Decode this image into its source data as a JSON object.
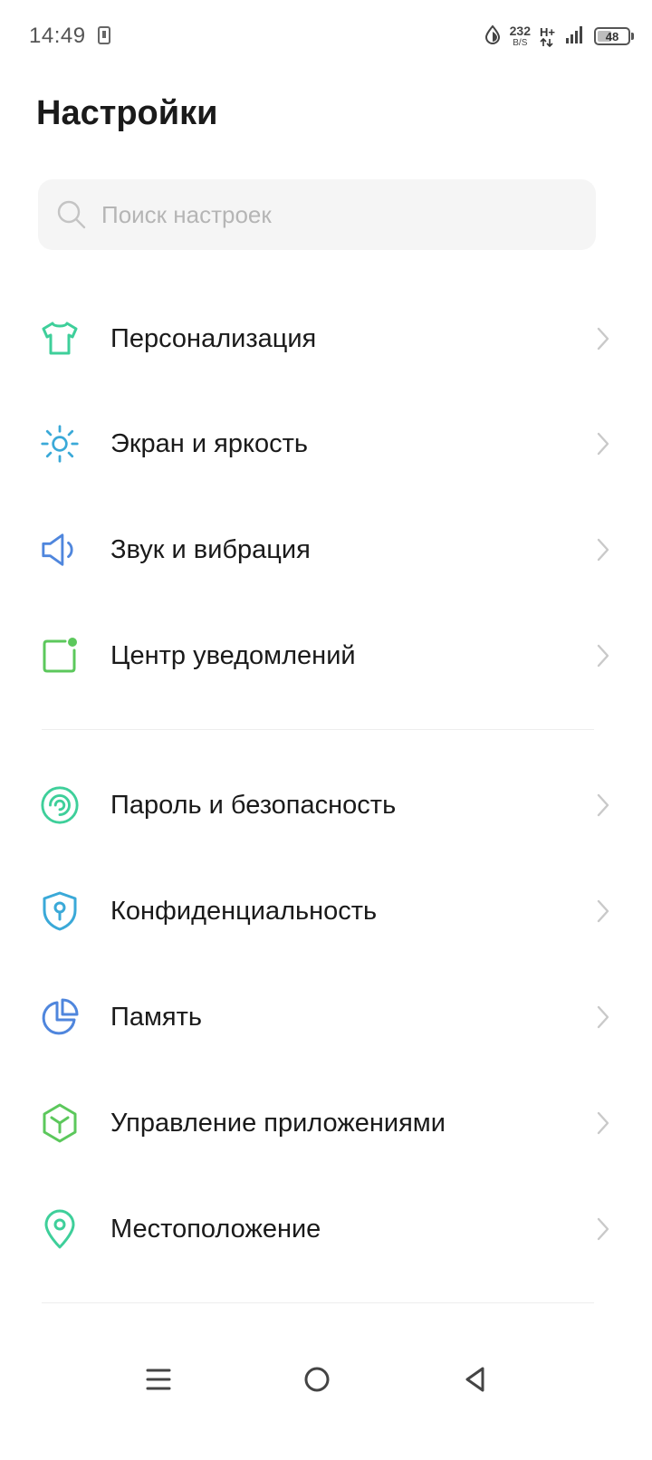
{
  "status_bar": {
    "time": "14:49",
    "net_speed_value": "232",
    "net_speed_unit": "B/S",
    "network_type": "H+",
    "battery_level": "48",
    "battery_percent": 48
  },
  "header": {
    "title": "Настройки"
  },
  "search": {
    "placeholder": "Поиск настроек",
    "value": ""
  },
  "settings": {
    "items": [
      {
        "label": "Персонализация",
        "icon": "tshirt-icon",
        "color": "#3ecf9a"
      },
      {
        "label": "Экран и яркость",
        "icon": "sun-icon",
        "color": "#3aa9d8"
      },
      {
        "label": "Звук и вибрация",
        "icon": "speaker-icon",
        "color": "#4f86dd"
      },
      {
        "label": "Центр уведомлений",
        "icon": "notification-icon",
        "color": "#5cc85c"
      },
      {
        "label": "Пароль и безопасность",
        "icon": "fingerprint-icon",
        "color": "#3ecf9a"
      },
      {
        "label": "Конфиденциальность",
        "icon": "shield-icon",
        "color": "#3aa9d8"
      },
      {
        "label": "Память",
        "icon": "pie-chart-icon",
        "color": "#4f86dd"
      },
      {
        "label": "Управление приложениями",
        "icon": "cube-icon",
        "color": "#5cc85c"
      },
      {
        "label": "Местоположение",
        "icon": "location-pin-icon",
        "color": "#3ecf9a"
      }
    ]
  },
  "nav_bar": {
    "menu_icon": "menu-icon",
    "home_icon": "home-circle-icon",
    "back_icon": "back-triangle-icon"
  }
}
